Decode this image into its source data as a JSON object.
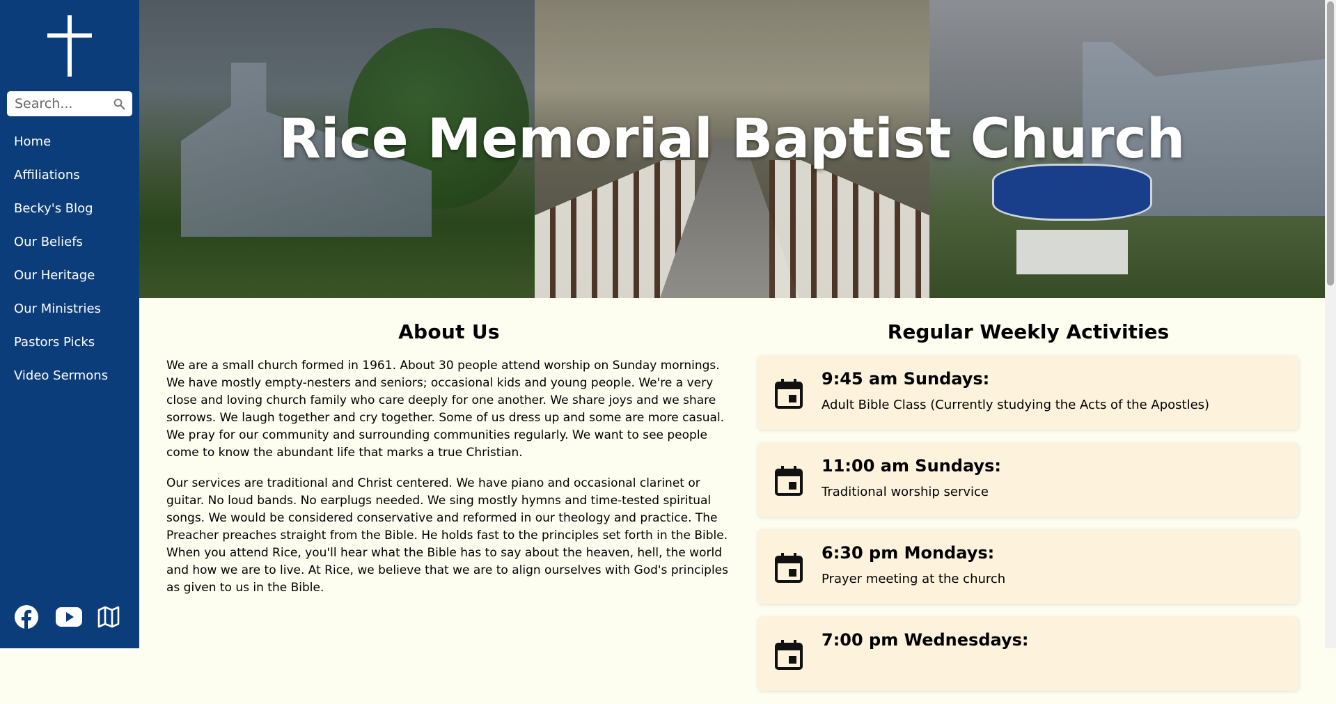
{
  "sidebar": {
    "search": {
      "placeholder": "Search..."
    },
    "nav": [
      {
        "label": "Home"
      },
      {
        "label": "Affiliations"
      },
      {
        "label": "Becky's Blog"
      },
      {
        "label": "Our Beliefs"
      },
      {
        "label": "Our Heritage"
      },
      {
        "label": "Our Ministries"
      },
      {
        "label": "Pastors Picks"
      },
      {
        "label": "Video Sermons"
      }
    ],
    "social_icons": [
      "facebook-icon",
      "youtube-icon",
      "map-icon"
    ]
  },
  "hero": {
    "title": "Rice Memorial Baptist Church"
  },
  "about": {
    "heading": "About Us",
    "paragraphs": [
      "We are a small church formed in 1961. About 30 people attend worship on Sunday mornings. We have mostly empty-nesters and seniors; occasional kids and young people. We're a very close and loving church family who care deeply for one another. We share joys and we share sorrows. We laugh together and cry together. Some of us dress up and some are more casual. We pray for our community and surrounding communities regularly. We want to see people come to know the abundant life that marks a true Christian.",
      "Our services are traditional and Christ centered. We have piano and occasional clarinet or guitar. No loud bands. No earplugs needed. We sing mostly hymns and time-tested spiritual songs. We would be considered conservative and reformed in our theology and practice. The Preacher preaches straight from the Bible. He holds fast to the principles set forth in the Bible. When you attend Rice, you'll hear what the Bible has to say about the heaven, hell, the world and how we are to live. At Rice, we believe that we are to align ourselves with God's principles as given to us in the Bible."
    ]
  },
  "activities": {
    "heading": "Regular Weekly Activities",
    "items": [
      {
        "when": "9:45 am Sundays:",
        "what": "Adult Bible Class (Currently studying the Acts of the Apostles)"
      },
      {
        "when": "11:00 am Sundays:",
        "what": "Traditional worship service"
      },
      {
        "when": "6:30 pm Mondays:",
        "what": "Prayer meeting at the church"
      },
      {
        "when": "7:00 pm Wednesdays:",
        "what": ""
      }
    ]
  },
  "colors": {
    "sidebar": "#0b3d7a",
    "page_background": "#fdfdf0",
    "card_background": "#fdf3dc"
  }
}
